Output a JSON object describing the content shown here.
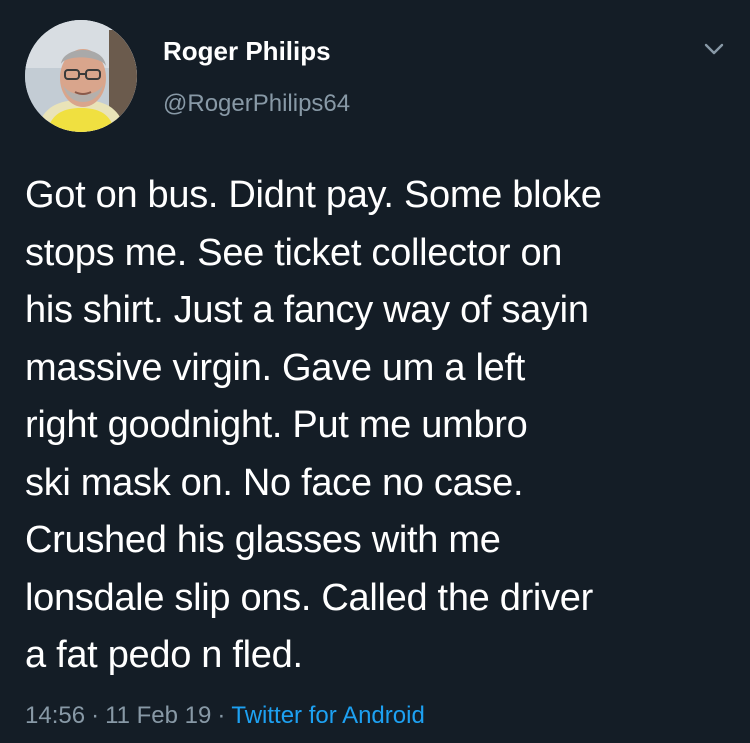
{
  "author": {
    "display_name": "Roger Philips",
    "handle": "@RogerPhilips64",
    "avatar_icon": "user-avatar-photo"
  },
  "menu": {
    "icon": "chevron-down-icon"
  },
  "tweet": {
    "lines": [
      "Got on bus. Didnt pay. Some bloke",
      "stops me. See ticket collector on",
      "his shirt. Just a fancy way of sayin",
      "massive virgin.  Gave um a left",
      "right goodnight. Put me umbro",
      "ski mask on. No face no case.",
      "Crushed his glasses with me",
      "lonsdale slip ons. Called the driver",
      "a fat pedo n fled."
    ]
  },
  "meta": {
    "time": "14:56",
    "separator": "·",
    "date": "11 Feb 19",
    "source": "Twitter for Android"
  },
  "colors": {
    "background": "#141d26",
    "text": "#ffffff",
    "secondary": "#8899a6",
    "link": "#1da1f2"
  }
}
